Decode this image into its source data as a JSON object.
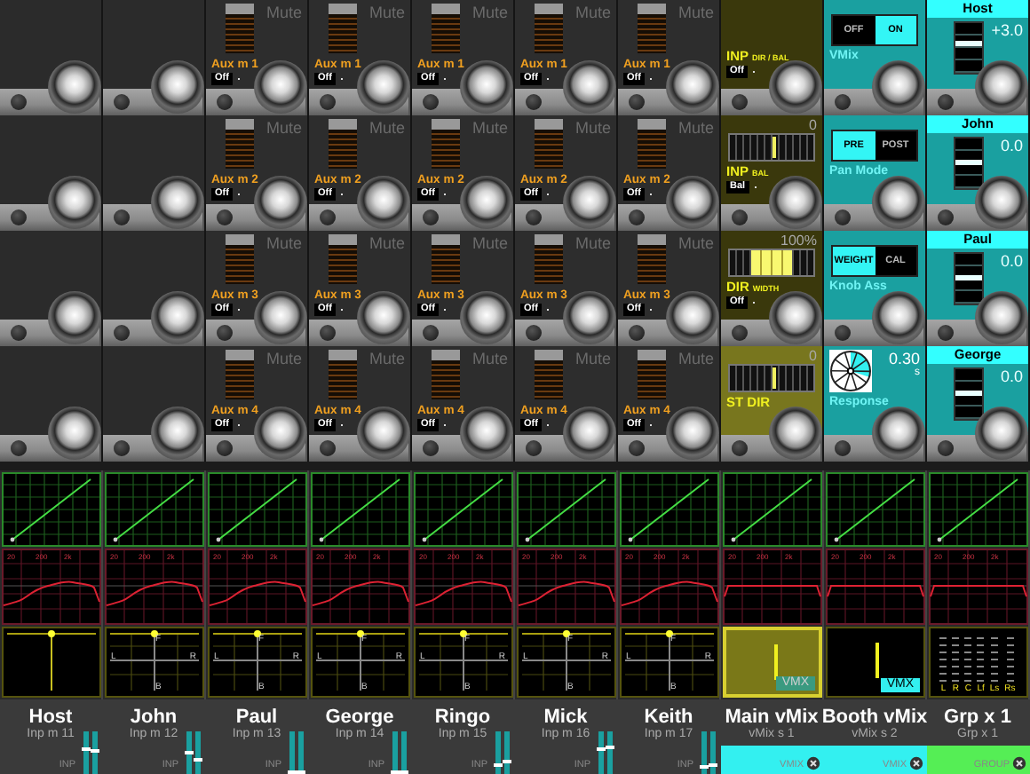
{
  "rows": [
    {
      "cells": [
        {
          "kind": "empty"
        },
        {
          "kind": "empty"
        },
        {
          "kind": "aux",
          "mute": "Mute",
          "label": "Aux m  1",
          "mode": "Off"
        },
        {
          "kind": "aux",
          "mute": "Mute",
          "label": "Aux m  1",
          "mode": "Off"
        },
        {
          "kind": "aux",
          "mute": "Mute",
          "label": "Aux m  1",
          "mode": "Off"
        },
        {
          "kind": "aux",
          "mute": "Mute",
          "label": "Aux m  1",
          "mode": "Off"
        },
        {
          "kind": "aux",
          "mute": "Mute",
          "label": "Aux m  1",
          "mode": "Off"
        },
        {
          "kind": "inp",
          "title": "INP",
          "sub": "DIR / BAL",
          "mode": "Off",
          "selected": false
        },
        {
          "kind": "toggle",
          "options": [
            {
              "label": "OFF",
              "selected": false
            },
            {
              "label": "ON",
              "selected": true
            }
          ],
          "caption": "VMix"
        },
        {
          "kind": "channel",
          "name": "Host",
          "value": "+3.0",
          "level": 0.55
        }
      ]
    },
    {
      "cells": [
        {
          "kind": "empty"
        },
        {
          "kind": "empty"
        },
        {
          "kind": "aux",
          "mute": "Mute",
          "label": "Aux m  2",
          "mode": "Off"
        },
        {
          "kind": "aux",
          "mute": "Mute",
          "label": "Aux m  2",
          "mode": "Off"
        },
        {
          "kind": "aux",
          "mute": "Mute",
          "label": "Aux m  2",
          "mode": "Off"
        },
        {
          "kind": "aux",
          "mute": "Mute",
          "label": "Aux m  2",
          "mode": "Off"
        },
        {
          "kind": "aux",
          "mute": "Mute",
          "label": "Aux m  2",
          "mode": "Off"
        },
        {
          "kind": "slider",
          "value": "0",
          "level": 0.5,
          "title": "INP",
          "sub": "BAL",
          "mode": "Bal",
          "selected": false
        },
        {
          "kind": "toggle",
          "options": [
            {
              "label": "PRE",
              "selected": true
            },
            {
              "label": "POST",
              "selected": false
            }
          ],
          "caption": "Pan Mode"
        },
        {
          "kind": "channel",
          "name": "John",
          "value": "0.0",
          "level": 0.45
        }
      ]
    },
    {
      "cells": [
        {
          "kind": "empty"
        },
        {
          "kind": "empty"
        },
        {
          "kind": "aux",
          "mute": "Mute",
          "label": "Aux m  3",
          "mode": "Off"
        },
        {
          "kind": "aux",
          "mute": "Mute",
          "label": "Aux m  3",
          "mode": "Off"
        },
        {
          "kind": "aux",
          "mute": "Mute",
          "label": "Aux m  3",
          "mode": "Off"
        },
        {
          "kind": "aux",
          "mute": "Mute",
          "label": "Aux m  3",
          "mode": "Off"
        },
        {
          "kind": "aux",
          "mute": "Mute",
          "label": "Aux m  3",
          "mode": "Off"
        },
        {
          "kind": "width",
          "value": "100%",
          "level": 0.5,
          "title": "DIR",
          "sub": "WIDTH",
          "mode": "Off",
          "selected": false
        },
        {
          "kind": "toggle",
          "options": [
            {
              "label": "WEIGHT",
              "selected": true
            },
            {
              "label": "CAL",
              "selected": false
            }
          ],
          "caption": "Knob Ass"
        },
        {
          "kind": "channel",
          "name": "Paul",
          "value": "0.0",
          "level": 0.45
        }
      ]
    },
    {
      "cells": [
        {
          "kind": "empty"
        },
        {
          "kind": "empty"
        },
        {
          "kind": "aux",
          "mute": "Mute",
          "label": "Aux m  4",
          "mode": "Off"
        },
        {
          "kind": "aux",
          "mute": "Mute",
          "label": "Aux m  4",
          "mode": "Off"
        },
        {
          "kind": "aux",
          "mute": "Mute",
          "label": "Aux m  4",
          "mode": "Off"
        },
        {
          "kind": "aux",
          "mute": "Mute",
          "label": "Aux m  4",
          "mode": "Off"
        },
        {
          "kind": "aux",
          "mute": "Mute",
          "label": "Aux m  4",
          "mode": "Off"
        },
        {
          "kind": "slider",
          "value": "0",
          "level": 0.5,
          "title": "ST DIR",
          "selected": true
        },
        {
          "kind": "dial",
          "value": "0.30",
          "unit": "s",
          "caption": "Response"
        },
        {
          "kind": "channel",
          "name": "George",
          "value": "0.0",
          "level": 0.45
        }
      ]
    }
  ],
  "strips": [
    {
      "name": "Host",
      "sub": "Inp m 11",
      "pan": {
        "kind": "mono"
      },
      "eq": {
        "kind": "curve",
        "labels": [
          "20",
          "200",
          "2k"
        ]
      },
      "footer": "INP",
      "color": "#3a3a3a",
      "selected": false,
      "faders": [
        {
          "level": 0.6
        },
        {
          "level": 0.55
        }
      ]
    },
    {
      "name": "John",
      "sub": "Inp m 12",
      "pan": {
        "kind": "stereo",
        "labels": [
          "F",
          "L",
          "R",
          "B"
        ]
      },
      "eq": {
        "kind": "curve",
        "labels": [
          "20",
          "200",
          "2k"
        ]
      },
      "footer": "INP",
      "color": "#3a3a3a",
      "selected": false,
      "faders": [
        {
          "level": 0.5
        },
        {
          "level": 0.35
        }
      ]
    },
    {
      "name": "Paul",
      "sub": "Inp m 13",
      "pan": {
        "kind": "stereo",
        "labels": [
          "F",
          "L",
          "R",
          "B"
        ]
      },
      "eq": {
        "kind": "curve",
        "labels": [
          "20",
          "200",
          "2k"
        ]
      },
      "footer": "INP",
      "color": "#3a3a3a",
      "selected": false,
      "faders": [
        {
          "level": 0.0
        },
        {
          "level": 0.0
        }
      ]
    },
    {
      "name": "George",
      "sub": "Inp m 14",
      "pan": {
        "kind": "stereo",
        "labels": [
          "F",
          "L",
          "R",
          "B"
        ]
      },
      "eq": {
        "kind": "curve",
        "labels": [
          "20",
          "200",
          "2k"
        ]
      },
      "footer": "INP",
      "color": "#3a3a3a",
      "selected": false,
      "faders": [
        {
          "level": 0.0
        },
        {
          "level": 0.0
        }
      ]
    },
    {
      "name": "Ringo",
      "sub": "Inp m 15",
      "pan": {
        "kind": "stereo",
        "labels": [
          "F",
          "L",
          "R",
          "B"
        ]
      },
      "eq": {
        "kind": "curve",
        "labels": [
          "20",
          "200",
          "2k"
        ]
      },
      "footer": "INP",
      "color": "#3a3a3a",
      "selected": false,
      "faders": [
        {
          "level": 0.2
        },
        {
          "level": 0.3
        }
      ]
    },
    {
      "name": "Mick",
      "sub": "Inp m 16",
      "pan": {
        "kind": "stereo",
        "labels": [
          "F",
          "L",
          "R",
          "B"
        ]
      },
      "eq": {
        "kind": "curve",
        "labels": [
          "20",
          "200",
          "2k"
        ]
      },
      "footer": "INP",
      "color": "#3a3a3a",
      "selected": false,
      "faders": [
        {
          "level": 0.6
        },
        {
          "level": 0.65
        }
      ]
    },
    {
      "name": "Keith",
      "sub": "Inp m 17",
      "pan": {
        "kind": "stereo",
        "labels": [
          "F",
          "L",
          "R",
          "B"
        ]
      },
      "eq": {
        "kind": "curve",
        "labels": [
          "20",
          "200",
          "2k"
        ]
      },
      "footer": "INP",
      "color": "#3a3a3a",
      "selected": false,
      "faders": [
        {
          "level": 0.15
        },
        {
          "level": 0.2
        }
      ]
    },
    {
      "name": "Main vMix",
      "sub": "vMix s  1",
      "pan": {
        "kind": "vmx",
        "tag": "VMX"
      },
      "eq": {
        "kind": "flat",
        "labels": [
          "20",
          "200",
          "2k"
        ]
      },
      "footer": "VMIX",
      "color": "#33f0f0",
      "selected": true
    },
    {
      "name": "Booth vMix",
      "sub": "vMix s  2",
      "pan": {
        "kind": "vmx",
        "tag": "VMX"
      },
      "eq": {
        "kind": "flat",
        "labels": [
          "20",
          "200",
          "2k"
        ]
      },
      "footer": "VMIX",
      "color": "#33f0f0",
      "selected": false
    },
    {
      "name": "Grp x  1",
      "sub": "Grp x  1",
      "pan": {
        "kind": "surround",
        "labels": [
          "L",
          "R",
          "C",
          "Lf",
          "Ls",
          "Rs"
        ]
      },
      "eq": {
        "kind": "flat",
        "labels": [
          "20",
          "200",
          "2k"
        ]
      },
      "footer": "GROUP",
      "color": "#55ee55",
      "selected": false
    }
  ]
}
